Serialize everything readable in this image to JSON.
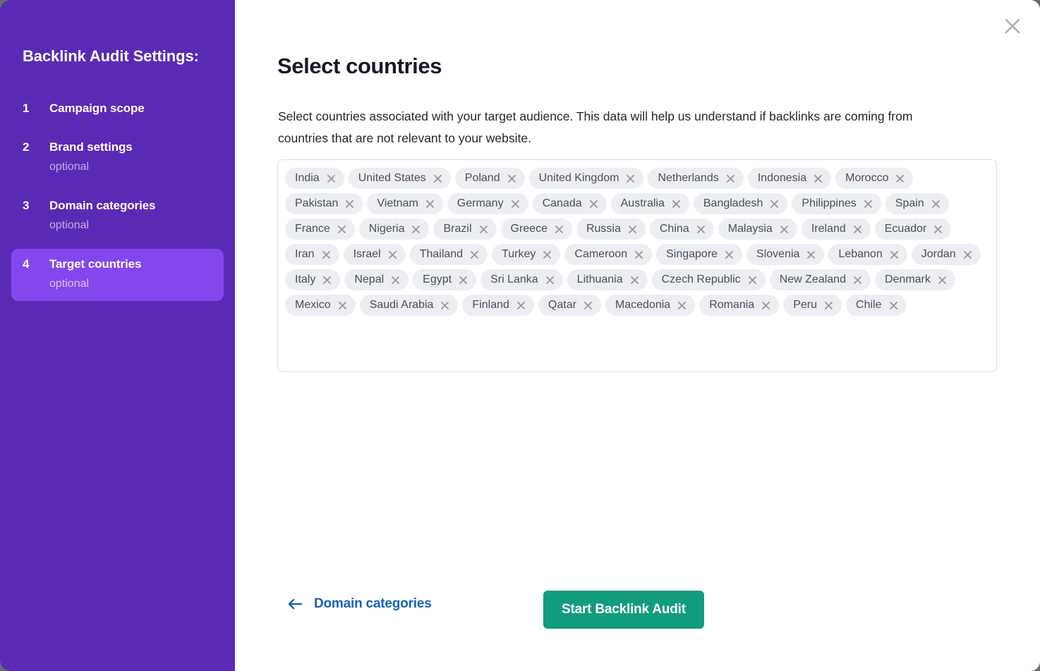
{
  "sidebar": {
    "title": "Backlink Audit Settings:",
    "items": [
      {
        "num": "1",
        "label": "Campaign scope",
        "sub": ""
      },
      {
        "num": "2",
        "label": "Brand settings",
        "sub": "optional"
      },
      {
        "num": "3",
        "label": "Domain categories",
        "sub": "optional"
      },
      {
        "num": "4",
        "label": "Target countries",
        "sub": "optional"
      }
    ],
    "active_index": 3,
    "bg_color": "#5b2ab5",
    "active_bg_color": "#8447ed"
  },
  "main": {
    "title": "Select countries",
    "description": "Select countries associated with your target audience. This data will help us understand if backlinks are coming from countries that are not relevant to your website.",
    "close_icon": "close-icon"
  },
  "countries": [
    "India",
    "United States",
    "Poland",
    "United Kingdom",
    "Netherlands",
    "Indonesia",
    "Morocco",
    "Pakistan",
    "Vietnam",
    "Germany",
    "Canada",
    "Australia",
    "Bangladesh",
    "Philippines",
    "Spain",
    "France",
    "Nigeria",
    "Brazil",
    "Greece",
    "Russia",
    "China",
    "Malaysia",
    "Ireland",
    "Ecuador",
    "Iran",
    "Israel",
    "Thailand",
    "Turkey",
    "Cameroon",
    "Singapore",
    "Slovenia",
    "Lebanon",
    "Jordan",
    "Italy",
    "Nepal",
    "Egypt",
    "Sri Lanka",
    "Lithuania",
    "Czech Republic",
    "New Zealand",
    "Denmark",
    "Mexico",
    "Saudi Arabia",
    "Finland",
    "Qatar",
    "Macedonia",
    "Romania",
    "Peru",
    "Chile"
  ],
  "footer": {
    "back_label": "Domain categories",
    "back_icon": "arrow-left-icon",
    "primary_label": "Start Backlink Audit",
    "primary_color": "#129c7e",
    "link_color": "#1763ba"
  }
}
